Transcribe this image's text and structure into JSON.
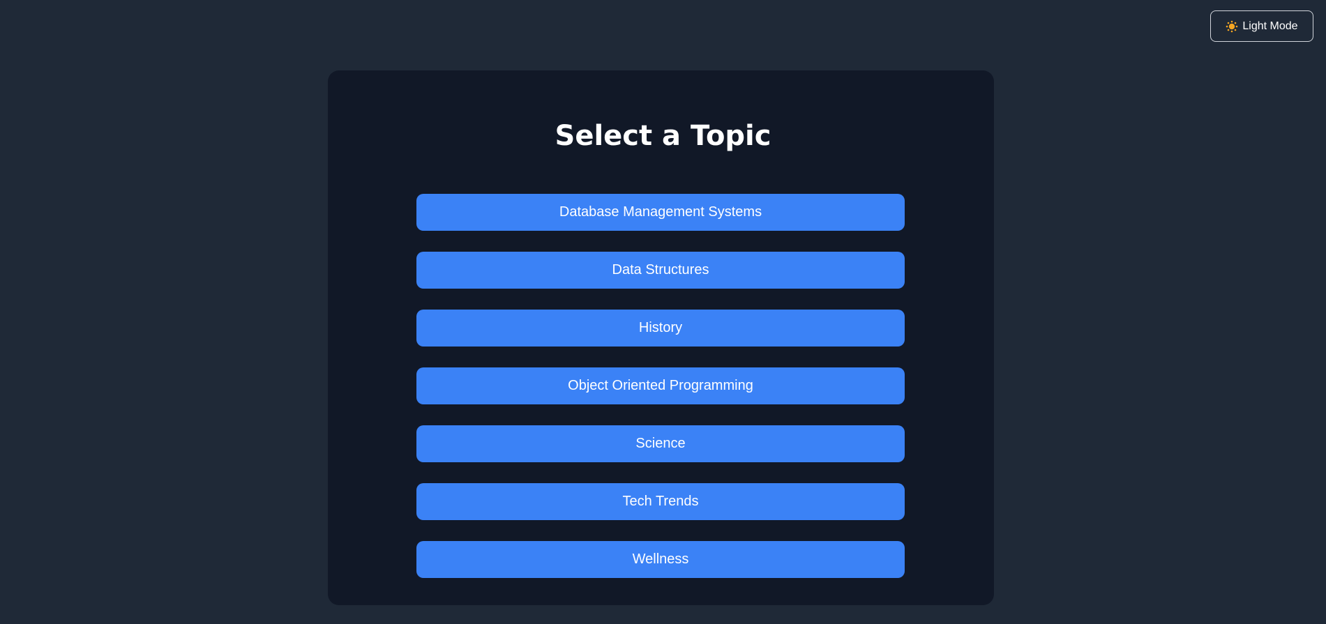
{
  "header": {
    "theme_toggle": {
      "icon": "sun-icon",
      "label": "Light Mode"
    }
  },
  "main": {
    "title": "Select a Topic",
    "topics": [
      {
        "label": "Database Management Systems"
      },
      {
        "label": "Data Structures"
      },
      {
        "label": "History"
      },
      {
        "label": "Object Oriented Programming"
      },
      {
        "label": "Science"
      },
      {
        "label": "Tech Trends"
      },
      {
        "label": "Wellness"
      }
    ]
  },
  "colors": {
    "page_background": "#1f2937",
    "card_background": "#111827",
    "accent": "#3b82f6",
    "sun_icon": "#f5a623",
    "text": "#ffffff"
  }
}
